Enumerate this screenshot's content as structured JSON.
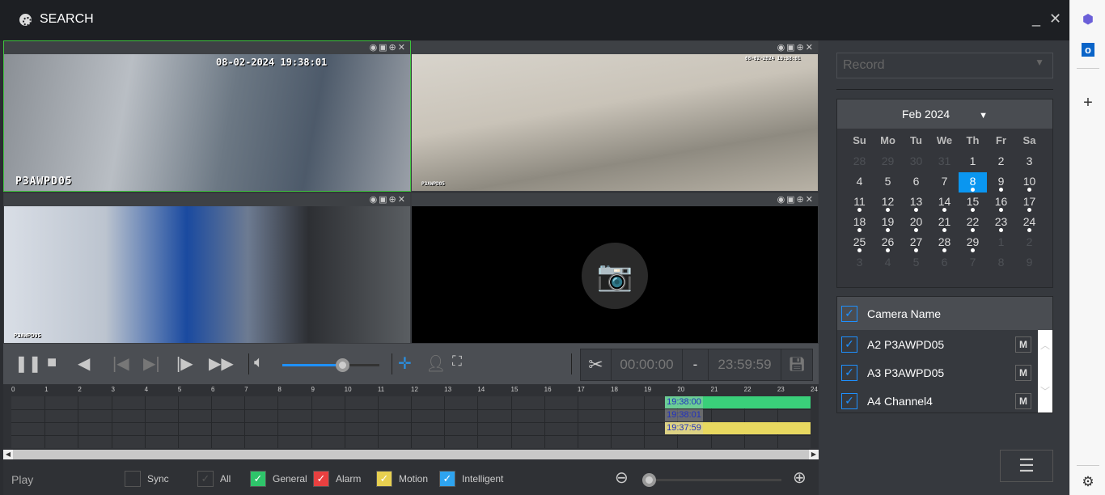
{
  "window": {
    "title": "SEARCH",
    "minimize": "_",
    "close": "✕"
  },
  "tiles": [
    {
      "osd_time": "08-02-2024 19:38:01",
      "osd_name": "P3AWPD05",
      "icons": "◉▣⊕✕"
    },
    {
      "osd_time": "08-02-2024 19:38:01",
      "osd_name": "P3AWPD05",
      "icons": "◉▣⊕✕"
    },
    {
      "osd_name": "P3AWPD05",
      "icons": "◉▣⊕✕"
    },
    {
      "icons": "◉▣⊕✕"
    }
  ],
  "controls": {
    "clip_start": "00:00:00",
    "clip_sep": "-",
    "clip_end": "23:59:59",
    "volume": 0.62
  },
  "timeline": {
    "hours": [
      "0",
      "1",
      "2",
      "3",
      "4",
      "5",
      "6",
      "7",
      "8",
      "9",
      "10",
      "11",
      "12",
      "13",
      "14",
      "15",
      "16",
      "17",
      "18",
      "19",
      "20",
      "21",
      "22",
      "23",
      "24"
    ],
    "tracks": [
      {
        "label": "19:38:00",
        "start": 19.63,
        "end": 24,
        "color": "#3ad07a"
      },
      {
        "label": "19:38:01",
        "start": 19.63,
        "end": 19.63,
        "color": "#e8d860"
      },
      {
        "label": "19:37:59",
        "start": 19.63,
        "end": 24,
        "color": "#e8d860"
      }
    ]
  },
  "bottom": {
    "play": "Play",
    "legend": [
      {
        "label": "Sync",
        "checked": false,
        "color": ""
      },
      {
        "label": "All",
        "checked": true,
        "color": ""
      },
      {
        "label": "General",
        "checked": true,
        "color": "#2ec46a"
      },
      {
        "label": "Alarm",
        "checked": true,
        "color": "#e84040"
      },
      {
        "label": "Motion",
        "checked": true,
        "color": "#e8d050"
      },
      {
        "label": "Intelligent",
        "checked": true,
        "color": "#2ea4f0"
      }
    ],
    "zoom": 0.0
  },
  "right": {
    "record_type": "Record",
    "calendar": {
      "month": "Feb 2024",
      "dow": [
        "Su",
        "Mo",
        "Tu",
        "We",
        "Th",
        "Fr",
        "Sa"
      ],
      "lead": [
        28,
        29,
        30,
        31
      ],
      "days": 29,
      "trail": [
        1,
        2,
        3,
        4,
        5,
        6,
        7,
        8,
        9
      ],
      "selected": 8,
      "recorded_from": 8,
      "recorded_to": 29
    },
    "camera_header": "Camera Name",
    "cameras": [
      {
        "name": "A2 P3AWPD05",
        "m": "M"
      },
      {
        "name": "A3 P3AWPD05",
        "m": "M"
      },
      {
        "name": "A4 Channel4",
        "m": "M"
      }
    ]
  }
}
